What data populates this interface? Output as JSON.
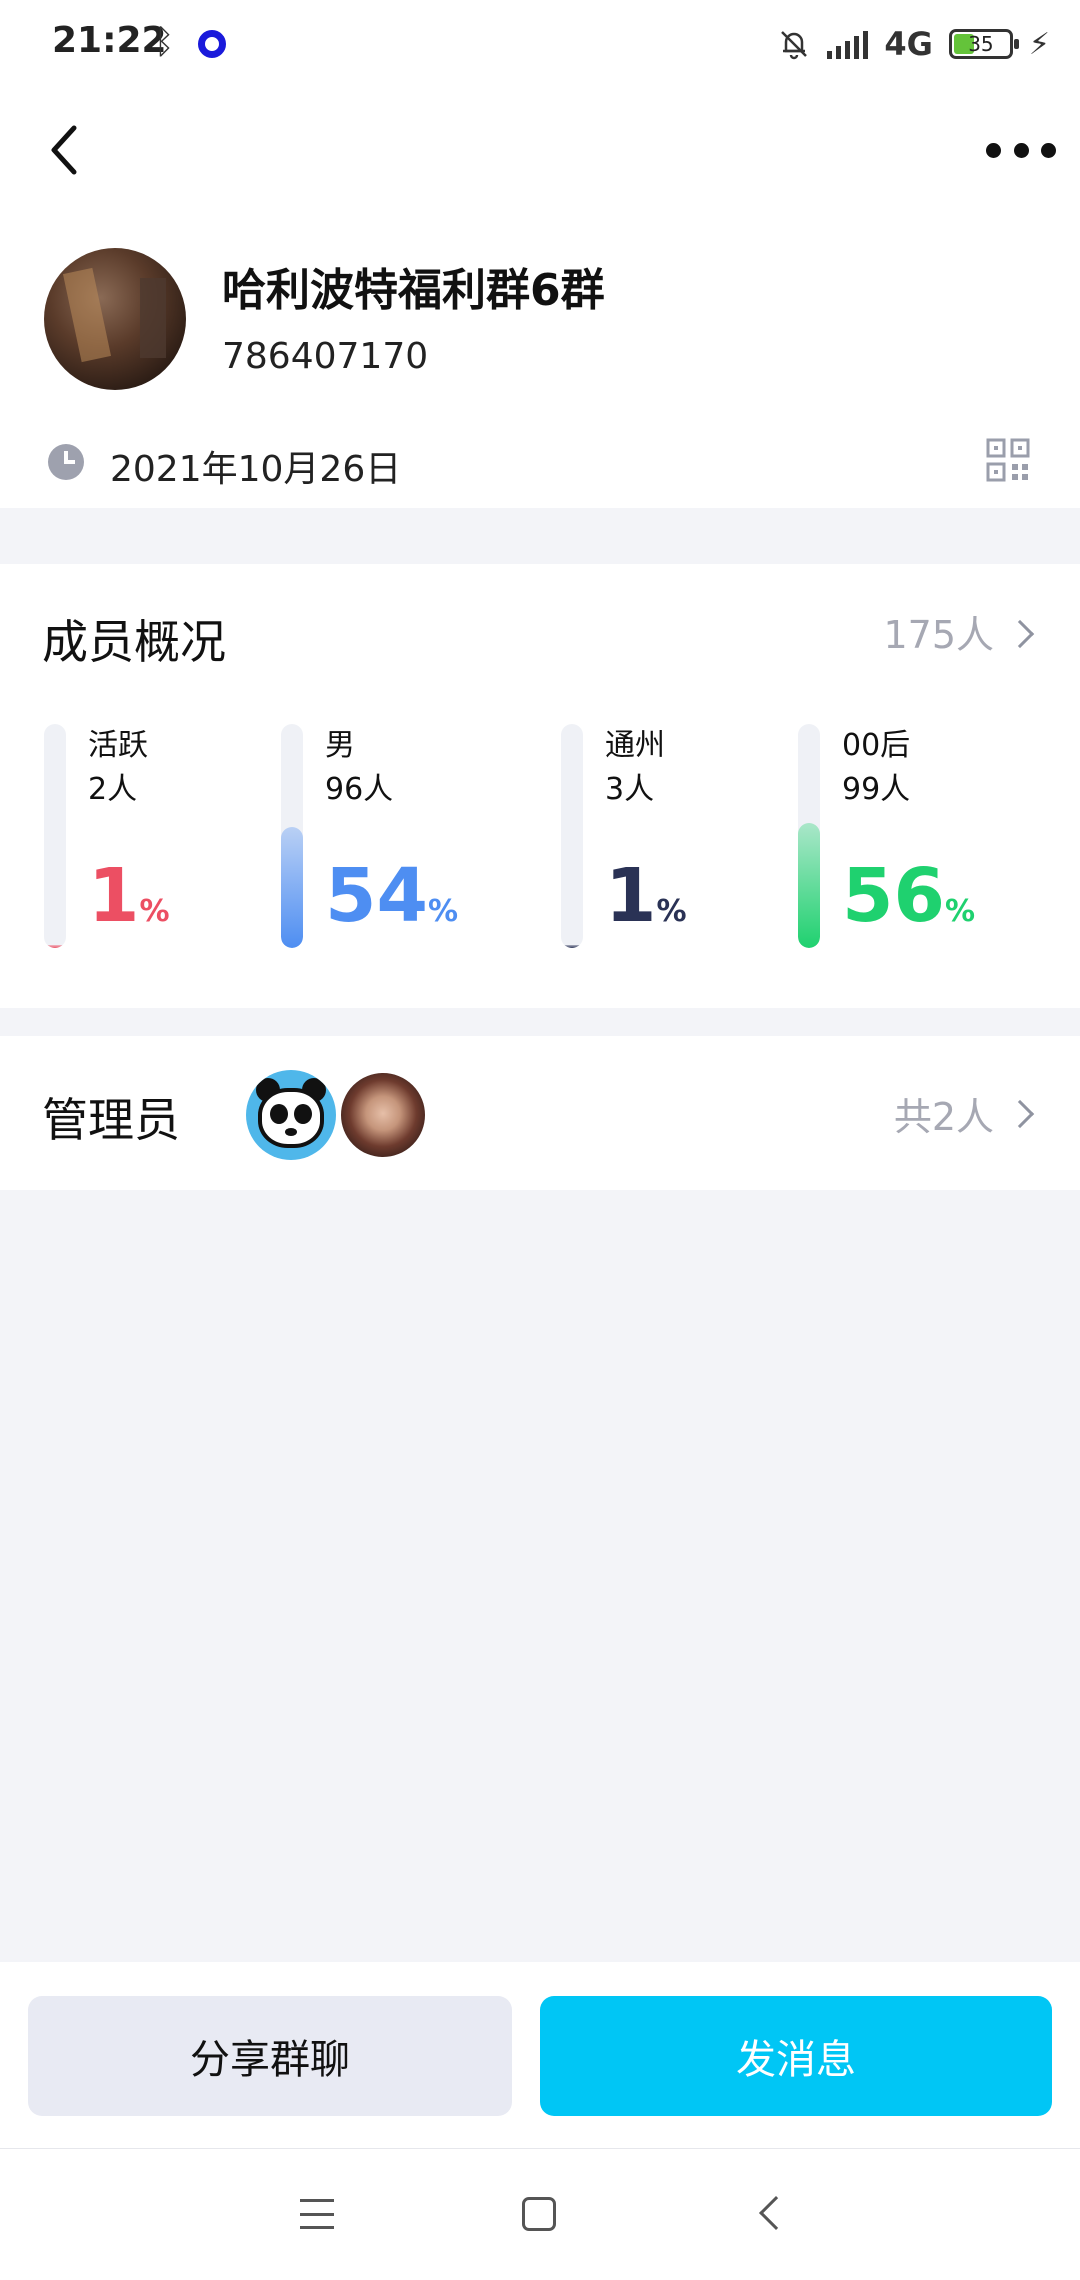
{
  "status_bar": {
    "time": "21:22",
    "network": "4G",
    "battery": "35"
  },
  "group": {
    "name": "哈利波特福利群6群",
    "id": "786407170",
    "created_date": "2021年10月26日"
  },
  "members": {
    "title": "成员概况",
    "total": "175人",
    "stats": [
      {
        "label": "活跃",
        "count": "2人",
        "percent": "1",
        "color": "#ec4f63"
      },
      {
        "label": "男",
        "count": "96人",
        "percent": "54",
        "color": "#4e8ef2"
      },
      {
        "label": "通州",
        "count": "3人",
        "percent": "1",
        "color": "#2a3255"
      },
      {
        "label": "00后",
        "count": "99人",
        "percent": "56",
        "color": "#1fd16f"
      }
    ],
    "percent_unit": "%"
  },
  "admins": {
    "title": "管理员",
    "total": "共2人"
  },
  "actions": {
    "share_label": "分享群聊",
    "send_label": "发消息"
  }
}
